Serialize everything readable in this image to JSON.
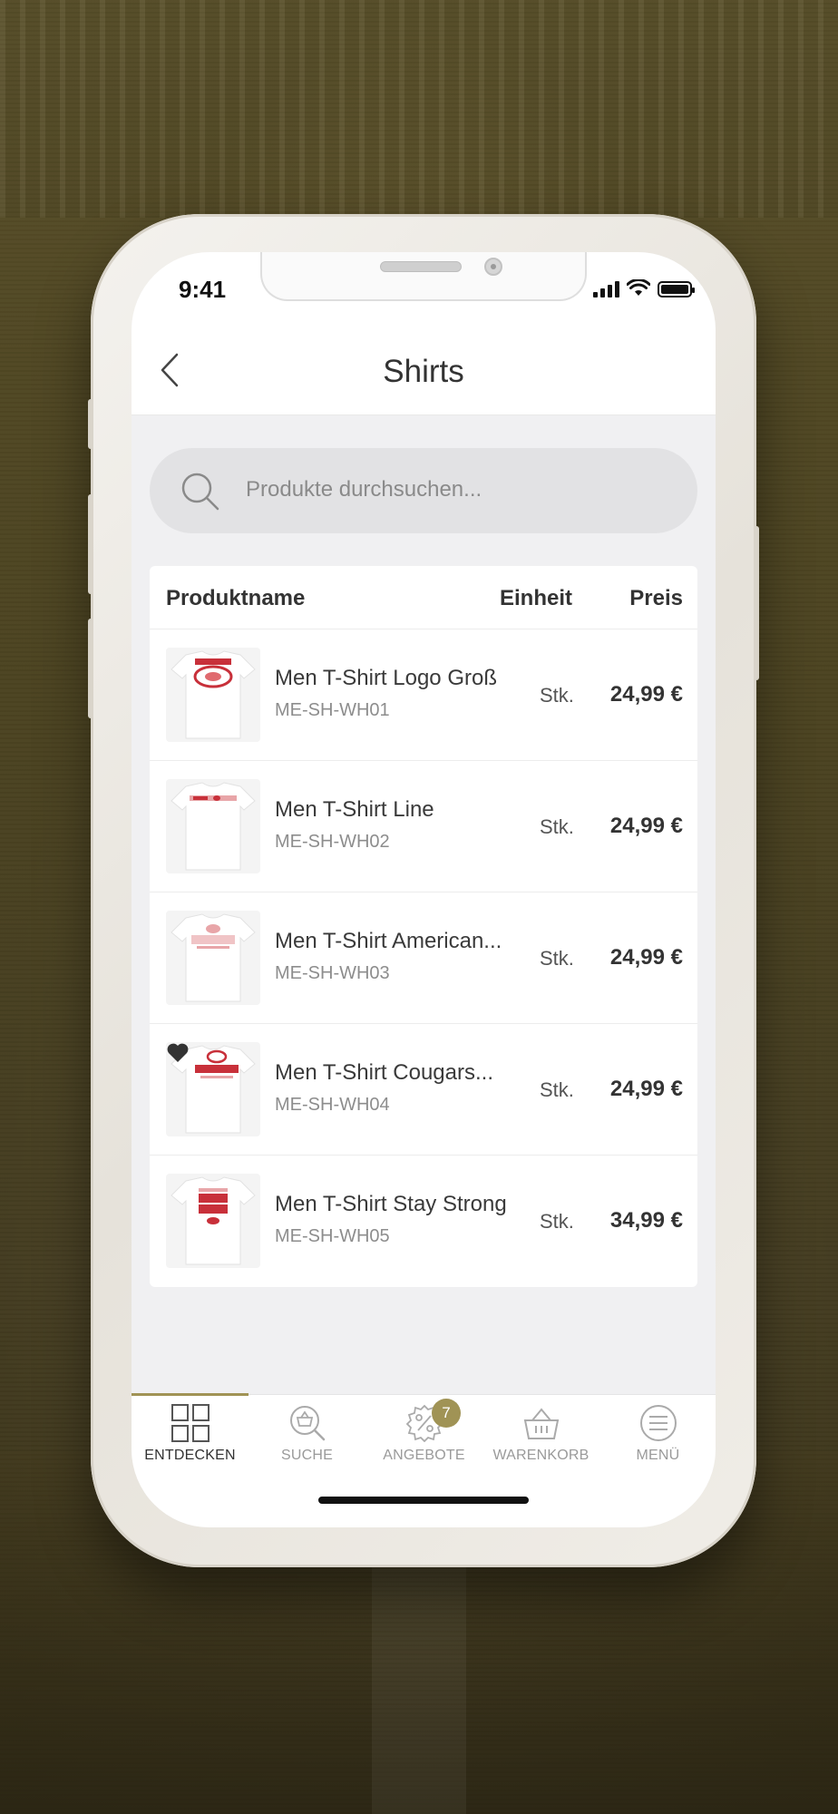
{
  "status": {
    "time": "9:41"
  },
  "navbar": {
    "title": "Shirts"
  },
  "search": {
    "placeholder": "Produkte durchsuchen..."
  },
  "table": {
    "headers": {
      "name": "Produktname",
      "unit": "Einheit",
      "price": "Preis"
    },
    "rows": [
      {
        "name": "Men T-Shirt Logo Groß",
        "sku": "ME-SH-WH01",
        "unit": "Stk.",
        "price": "24,99 €",
        "favorite": false
      },
      {
        "name": "Men T-Shirt Line",
        "sku": "ME-SH-WH02",
        "unit": "Stk.",
        "price": "24,99 €",
        "favorite": false
      },
      {
        "name": "Men T-Shirt American...",
        "sku": "ME-SH-WH03",
        "unit": "Stk.",
        "price": "24,99 €",
        "favorite": false
      },
      {
        "name": "Men T-Shirt Cougars...",
        "sku": "ME-SH-WH04",
        "unit": "Stk.",
        "price": "24,99 €",
        "favorite": true
      },
      {
        "name": "Men T-Shirt Stay Strong",
        "sku": "ME-SH-WH05",
        "unit": "Stk.",
        "price": "34,99 €",
        "favorite": false
      }
    ]
  },
  "tabbar": {
    "items": [
      {
        "label": "ENTDECKEN",
        "icon": "grid-icon",
        "active": true
      },
      {
        "label": "SUCHE",
        "icon": "search-basket-icon",
        "active": false
      },
      {
        "label": "ANGEBOTE",
        "icon": "percent-badge-icon",
        "active": false,
        "badge": "7"
      },
      {
        "label": "WARENKORB",
        "icon": "basket-icon",
        "active": false
      },
      {
        "label": "MENÜ",
        "icon": "menu-icon",
        "active": false
      }
    ]
  },
  "colors": {
    "accent": "#a09355",
    "background": "#6e6430"
  }
}
